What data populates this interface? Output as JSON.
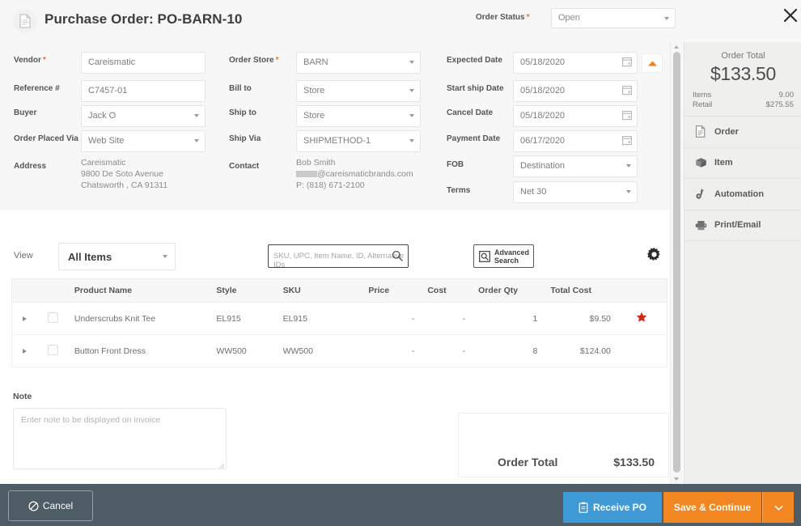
{
  "header": {
    "title": "Purchase Order: PO-BARN-10",
    "doc_icon": "document-icon",
    "close_icon": "close-icon",
    "order_status_label": "Order Status",
    "order_status_required": "*",
    "order_status_value": "Open"
  },
  "form": {
    "left": [
      {
        "label": "Vendor",
        "required": "*",
        "value": "Careismatic",
        "type": "text"
      },
      {
        "label": "Reference #",
        "required": "",
        "value": "C7457-01",
        "type": "text"
      },
      {
        "label": "Buyer",
        "required": "",
        "value": "Jack O",
        "type": "select"
      },
      {
        "label": "Order Placed Via",
        "required": "",
        "value": "Web Site",
        "type": "select"
      }
    ],
    "address_label": "Address",
    "address_lines": [
      "Careismatic",
      "9800 De Soto Avenue",
      "Chatsworth , CA 91311"
    ],
    "middle": [
      {
        "label": "Order Store",
        "required": "*",
        "value": "BARN",
        "type": "select"
      },
      {
        "label": "Bill to",
        "required": "",
        "value": "Store",
        "type": "select"
      },
      {
        "label": "Ship to",
        "required": "",
        "value": "Store",
        "type": "select"
      },
      {
        "label": "Ship Via",
        "required": "",
        "value": "SHIPMETHOD-1",
        "type": "select"
      }
    ],
    "contact_label": "Contact",
    "contact_name": "Bob Smith",
    "contact_email_suffix": "@careismaticbrands.com",
    "contact_phone": "P: (818) 671-2100",
    "right": [
      {
        "label": "Expected Date",
        "required": "",
        "value": "05/18/2020",
        "type": "date"
      },
      {
        "label": "Start ship Date",
        "required": "",
        "value": "05/18/2020",
        "type": "date"
      },
      {
        "label": "Cancel Date",
        "required": "",
        "value": "05/18/2020",
        "type": "date"
      },
      {
        "label": "Payment Date",
        "required": "",
        "value": "06/17/2020",
        "type": "date"
      },
      {
        "label": "FOB",
        "required": "",
        "value": "Destination",
        "type": "select"
      },
      {
        "label": "Terms",
        "required": "",
        "value": "Net 30",
        "type": "select"
      }
    ],
    "collapse_icon": "chevron-up-icon"
  },
  "rail": {
    "total_caption": "Order Total",
    "total_amount": "$133.50",
    "items_label": "Items",
    "items_value": "9.00",
    "retail_label": "Retail",
    "retail_value": "$275.55",
    "nav": [
      {
        "label": "Order",
        "icon": "document-icon"
      },
      {
        "label": "Item",
        "icon": "box-icon"
      },
      {
        "label": "Automation",
        "icon": "automation-icon"
      },
      {
        "label": "Print/Email",
        "icon": "printer-icon"
      }
    ]
  },
  "toolbar": {
    "view_label": "View",
    "view_value": "All Items",
    "search_placeholder": "SKU, UPC, Item Name, ID, Alternative IDs",
    "search_value": "",
    "search_icon": "search-icon",
    "advanced_search_line1": "Advanced",
    "advanced_search_line2": "Search",
    "advanced_search_icon": "advanced-search-icon",
    "settings_icon": "gear-icon"
  },
  "table": {
    "columns": [
      "",
      "",
      "Product Name",
      "Style",
      "SKU",
      "Price",
      "Cost",
      "Order Qty",
      "Total Cost",
      ""
    ],
    "rows": [
      {
        "product_name": "Underscrubs Knit Tee",
        "style": "EL915",
        "sku": "EL915",
        "price": "-",
        "cost": "-",
        "order_qty": "1",
        "total_cost": "$9.50",
        "flag": "star-icon"
      },
      {
        "product_name": "Button Front Dress",
        "style": "WW500",
        "sku": "WW500",
        "price": "-",
        "cost": "-",
        "order_qty": "8",
        "total_cost": "$124.00",
        "flag": ""
      }
    ]
  },
  "note": {
    "label": "Note",
    "placeholder": "Enter note to be displayed on invoice",
    "value": ""
  },
  "totals": {
    "label": "Order Total",
    "amount": "$133.50"
  },
  "footer": {
    "cancel_label": "Cancel",
    "cancel_icon": "no-entry-icon",
    "receive_label": "Receive PO",
    "receive_icon": "clipboard-icon",
    "save_label": "Save & Continue",
    "save_more_icon": "chevron-down-icon"
  },
  "colors": {
    "accent_orange": "#f28620",
    "accent_blue": "#3f99d4",
    "footer_bg": "#4e5c65",
    "panel_bg": "#f7f7f7",
    "rail_bg": "#efefee",
    "star_red": "#d62617",
    "required_marker": "#e8762c"
  }
}
